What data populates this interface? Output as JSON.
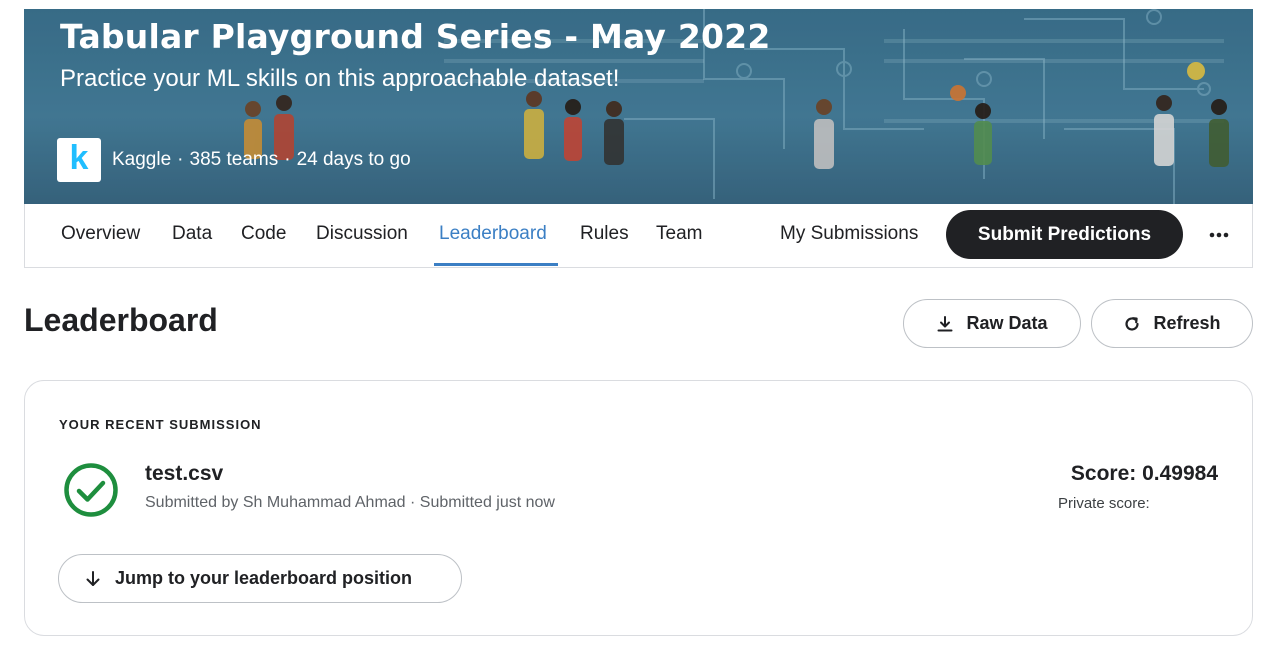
{
  "banner": {
    "title": "Tabular Playground Series - May 2022",
    "subtitle": "Practice your ML skills on this approachable dataset!",
    "logo_letter": "k",
    "host": "Kaggle",
    "teams": "385 teams",
    "deadline": "24 days to go",
    "separator": "·"
  },
  "tabs": [
    {
      "label": "Overview"
    },
    {
      "label": "Data"
    },
    {
      "label": "Code"
    },
    {
      "label": "Discussion"
    },
    {
      "label": "Leaderboard",
      "active": true
    },
    {
      "label": "Rules"
    },
    {
      "label": "Team"
    }
  ],
  "nav_right": {
    "my_submissions": "My Submissions",
    "submit_predictions": "Submit Predictions",
    "more_icon": "more-horizontal-icon"
  },
  "page": {
    "title": "Leaderboard",
    "raw_data_label": "Raw Data",
    "raw_data_icon": "download-icon",
    "refresh_label": "Refresh",
    "refresh_icon": "refresh-icon"
  },
  "submission": {
    "section_label": "YOUR RECENT SUBMISSION",
    "status_icon": "check-circle-icon",
    "file_name": "test.csv",
    "submitted_by": "Submitted by Sh Muhammad Ahmad · Submitted just now",
    "score": "Score: 0.49984",
    "private_score": "Private score:",
    "jump_label": "Jump to your leaderboard position",
    "jump_icon": "arrow-down-icon"
  },
  "colors": {
    "accent": "#3b7fc4",
    "success": "#1e8e3e",
    "primary_button": "#202124",
    "banner_bg": "#4a87a6"
  }
}
